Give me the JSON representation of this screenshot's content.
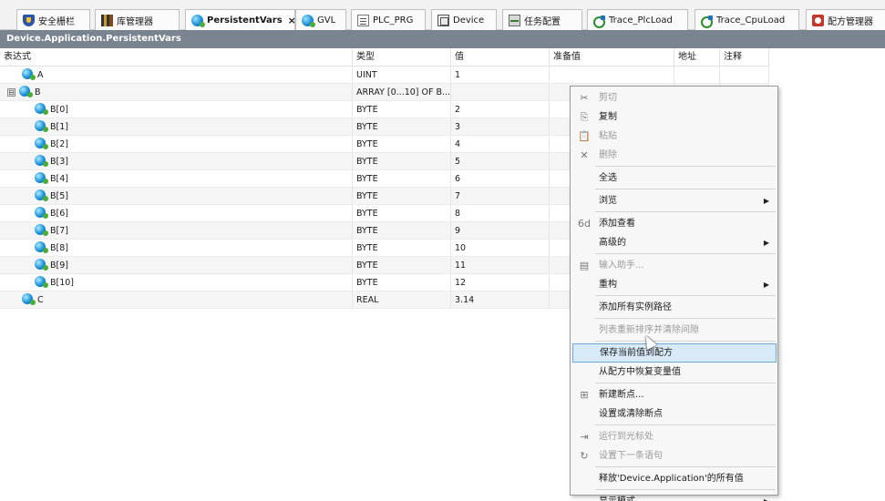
{
  "tabs": [
    {
      "label": "安全栅栏",
      "icon": "shield-icon",
      "active": false
    },
    {
      "label": "库管理器",
      "icon": "library-icon",
      "active": false
    },
    {
      "label": "PersistentVars",
      "icon": "persistent-vars-icon",
      "active": true,
      "close": "×"
    },
    {
      "label": "GVL",
      "icon": "gvl-icon",
      "active": false
    },
    {
      "label": "PLC_PRG",
      "icon": "program-icon",
      "active": false
    },
    {
      "label": "Device",
      "icon": "device-icon",
      "active": false
    },
    {
      "label": "任务配置",
      "icon": "task-config-icon",
      "active": false
    },
    {
      "label": "Trace_PlcLoad",
      "icon": "trace-icon",
      "active": false
    },
    {
      "label": "Trace_CpuLoad",
      "icon": "trace-icon",
      "active": false
    },
    {
      "label": "配方管理器",
      "icon": "recipe-icon",
      "active": false
    }
  ],
  "path": "Device.Application.PersistentVars",
  "columns": {
    "expression": "表达式",
    "type": "类型",
    "value": "值",
    "prepared": "准备值",
    "address": "地址",
    "comment": "注释"
  },
  "rows": [
    {
      "name": "A",
      "type": "UINT",
      "value": "1",
      "level": 0
    },
    {
      "name": "B",
      "type": "ARRAY [0...10] OF B...",
      "value": "",
      "level": 0,
      "expander": "⊟"
    },
    {
      "name": "B[0]",
      "type": "BYTE",
      "value": "2",
      "level": 1
    },
    {
      "name": "B[1]",
      "type": "BYTE",
      "value": "3",
      "level": 1
    },
    {
      "name": "B[2]",
      "type": "BYTE",
      "value": "4",
      "level": 1
    },
    {
      "name": "B[3]",
      "type": "BYTE",
      "value": "5",
      "level": 1
    },
    {
      "name": "B[4]",
      "type": "BYTE",
      "value": "6",
      "level": 1
    },
    {
      "name": "B[5]",
      "type": "BYTE",
      "value": "7",
      "level": 1
    },
    {
      "name": "B[6]",
      "type": "BYTE",
      "value": "8",
      "level": 1
    },
    {
      "name": "B[7]",
      "type": "BYTE",
      "value": "9",
      "level": 1
    },
    {
      "name": "B[8]",
      "type": "BYTE",
      "value": "10",
      "level": 1
    },
    {
      "name": "B[9]",
      "type": "BYTE",
      "value": "11",
      "level": 1
    },
    {
      "name": "B[10]",
      "type": "BYTE",
      "value": "12",
      "level": 1
    },
    {
      "name": "C",
      "type": "REAL",
      "value": "3.14",
      "level": 0
    }
  ],
  "context_menu": {
    "items": [
      {
        "label": "剪切",
        "disabled": true,
        "icon": "scissors-icon",
        "glyph": "✂"
      },
      {
        "label": "复制",
        "disabled": false,
        "icon": "copy-icon",
        "glyph": "⎘"
      },
      {
        "label": "粘贴",
        "disabled": true,
        "icon": "paste-icon",
        "glyph": "📋"
      },
      {
        "label": "删除",
        "disabled": true,
        "icon": "delete-icon",
        "glyph": "✕"
      },
      {
        "separator": true
      },
      {
        "label": "全选",
        "disabled": false
      },
      {
        "separator": true
      },
      {
        "label": "浏览",
        "disabled": false,
        "submenu": true
      },
      {
        "separator": true
      },
      {
        "label": "添加查看",
        "disabled": false,
        "icon": "add-watch-icon",
        "glyph": "6d"
      },
      {
        "label": "高级的",
        "disabled": false,
        "submenu": true
      },
      {
        "separator": true
      },
      {
        "label": "输入助手...",
        "disabled": true,
        "icon": "input-assistant-icon",
        "glyph": "▤"
      },
      {
        "label": "重构",
        "disabled": false,
        "submenu": true
      },
      {
        "separator": true
      },
      {
        "label": "添加所有实例路径",
        "disabled": false
      },
      {
        "separator": true
      },
      {
        "label": "列表重新排序并清除间隙",
        "disabled": true
      },
      {
        "separator": true
      },
      {
        "label": "保存当前值到配方",
        "disabled": false,
        "hover": true
      },
      {
        "label": "从配方中恢复变量值",
        "disabled": false
      },
      {
        "separator": true
      },
      {
        "label": "新建断点...",
        "disabled": false,
        "icon": "breakpoint-icon",
        "glyph": "⊞"
      },
      {
        "label": "设置或清除断点",
        "disabled": false
      },
      {
        "separator": true
      },
      {
        "label": "运行到光标处",
        "disabled": true,
        "icon": "run-to-cursor-icon",
        "glyph": "⇥"
      },
      {
        "label": "设置下一条语句",
        "disabled": true,
        "icon": "set-next-statement-icon",
        "glyph": "↻"
      },
      {
        "separator": true
      },
      {
        "label": "释放'Device.Application'的所有值",
        "disabled": false
      },
      {
        "separator": true
      },
      {
        "label": "显示模式",
        "disabled": false,
        "submenu": true
      }
    ],
    "submenu_arrow": "▶"
  }
}
